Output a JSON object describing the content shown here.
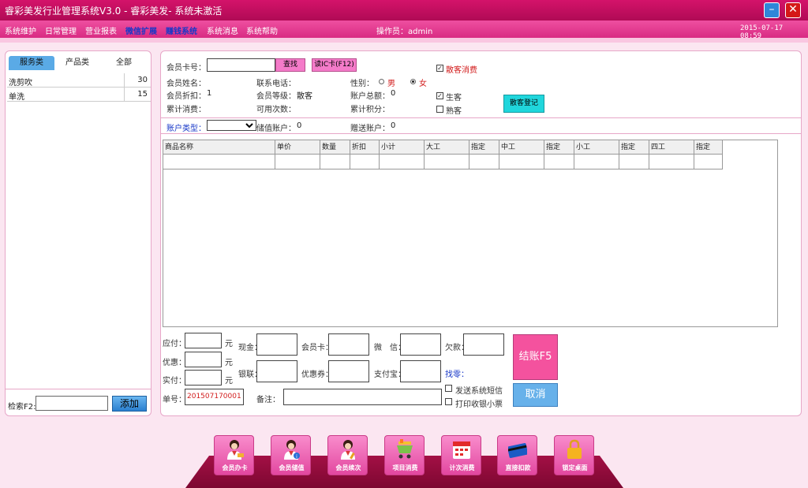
{
  "window": {
    "title": "睿彩美发行业管理系统V3.0 - 睿彩美发- 系统未激活",
    "minimize_icon": "minimize-icon",
    "close_icon": "close-icon"
  },
  "menu": {
    "items": [
      "系统维护",
      "日常管理",
      "营业报表",
      "微信扩展",
      "赚钱系统",
      "系统消息",
      "系统帮助"
    ],
    "operator": "操作员：admin",
    "datetime": "2015-07-17 08:59"
  },
  "left_panel": {
    "tabs": [
      "服务类",
      "产品类",
      "全部"
    ],
    "services": [
      {
        "name": "洗剪吹",
        "price": "30"
      },
      {
        "name": "单洗",
        "price": "15"
      }
    ],
    "search_label": "检索F2:",
    "add_button": "添加"
  },
  "member": {
    "card_label": "会员卡号：",
    "find_button": "查找",
    "read_ic_button": "读IC卡(F12)",
    "name_label": "会员姓名：",
    "phone_label": "联系电话：",
    "gender_label": "性别：",
    "male": "男",
    "female": "女",
    "discount_label": "会员折扣：",
    "discount_value": "1",
    "level_label": "会员等级：",
    "level_value": "散客",
    "balance_label": "账户总额：",
    "balance_value": "0",
    "total_spend_label": "累计消费：",
    "available_times_label": "可用次数：",
    "points_label": "累计积分：",
    "walkin_label": "散客消费",
    "new_customer": "生客",
    "regular_customer": "熟客",
    "register_button": "散客登记",
    "account_type_label": "账户类型：",
    "stored_label": "储值账户：",
    "stored_value": "0",
    "gift_label": "赠送账户：",
    "gift_value": "0"
  },
  "grid": {
    "headers": [
      "商品名称",
      "单价",
      "数量",
      "折扣",
      "小计",
      "大工",
      "指定",
      "中工",
      "指定",
      "小工",
      "指定",
      "四工",
      "指定"
    ]
  },
  "payment": {
    "payable": "应付：",
    "discount": "优惠：",
    "actual": "实付：",
    "unit": "元",
    "cash": "现金：",
    "member_card": "会员卡：",
    "wechat": "微　信：",
    "debt": "欠款：",
    "unionpay": "银联：",
    "coupon": "优惠券：",
    "alipay": "支付宝：",
    "change": "找零：",
    "order_label": "单号：",
    "order_no": "201507170001",
    "remark_label": "备注：",
    "send_sms": "发送系统短信",
    "print_receipt": "打印收银小票",
    "settle_button": "结账F5",
    "cancel_button": "取消"
  },
  "dock": [
    {
      "label": "会员办卡",
      "icon": "member-card-icon"
    },
    {
      "label": "会员储值",
      "icon": "member-deposit-icon"
    },
    {
      "label": "会员续次",
      "icon": "member-renew-icon"
    },
    {
      "label": "项目消费",
      "icon": "cart-icon"
    },
    {
      "label": "计次消费",
      "icon": "calendar-icon"
    },
    {
      "label": "直接扣款",
      "icon": "bank-card-icon"
    },
    {
      "label": "锁定桌面",
      "icon": "lock-icon"
    }
  ],
  "colors": {
    "title_bar": "#c0105e",
    "menu_bar": "#e43b90",
    "highlight_menu": "#1838c8",
    "settle": "#f4529e",
    "cancel": "#67b1ea"
  }
}
